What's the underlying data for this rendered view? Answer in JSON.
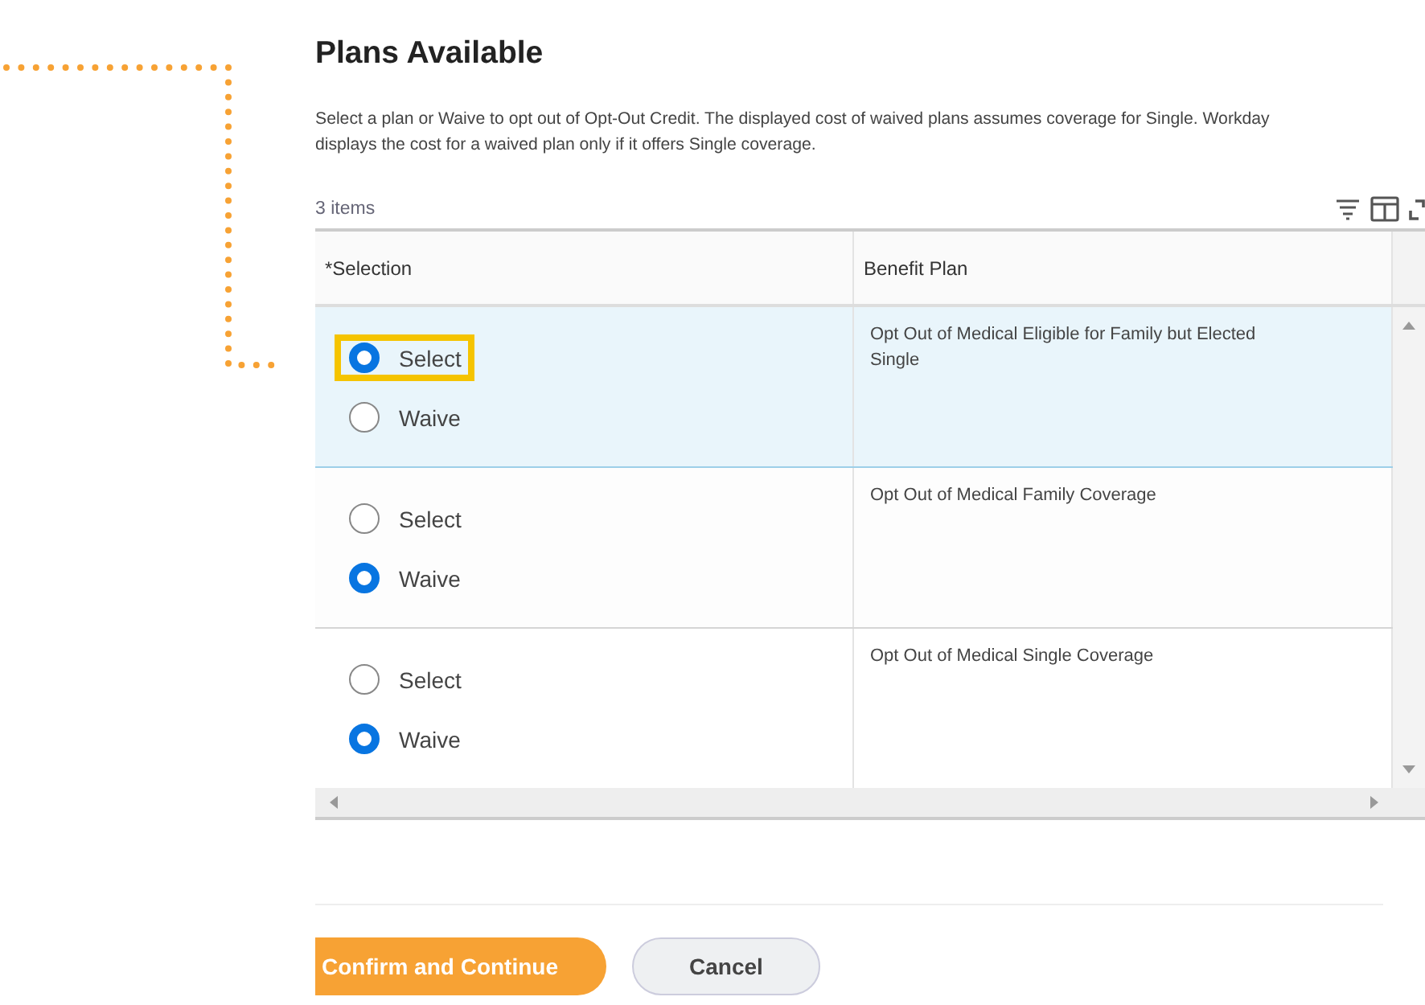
{
  "title": "Plans Available",
  "description_lines": [
    "Select a plan or Waive to opt out of Opt-Out Credit. The displayed cost of waived plans assumes coverage for Single. Workday",
    "displays the cost for a waived plan only if it offers Single coverage."
  ],
  "table": {
    "count": "3 items",
    "columns": [
      "*Selection",
      "Benefit Plan"
    ],
    "rows": [
      {
        "selected": true,
        "plan": "Opt Out of Medical Eligible for Family but Elected Single",
        "options": [
          {
            "label": "Select",
            "selected": true,
            "callout": true
          },
          {
            "label": "Waive",
            "selected": false,
            "callout": false
          }
        ]
      },
      {
        "selected": false,
        "plan": "Opt Out of Medical Family Coverage",
        "options": [
          {
            "label": "Select",
            "selected": false,
            "callout": false
          },
          {
            "label": "Waive",
            "selected": true,
            "callout": false
          }
        ]
      },
      {
        "selected": false,
        "plan": "Opt Out of Medical Single Coverage",
        "options": [
          {
            "label": "Select",
            "selected": false,
            "callout": false
          },
          {
            "label": "Waive",
            "selected": true,
            "callout": false
          }
        ]
      }
    ]
  },
  "buttons": [
    {
      "label": "Confirm and Continue",
      "kind": "primary"
    },
    {
      "label": "Cancel",
      "kind": "secondary"
    }
  ]
}
